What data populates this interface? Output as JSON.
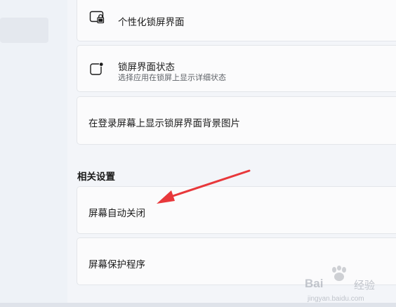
{
  "settings": {
    "rows": [
      {
        "title": "个性化锁屏界面",
        "icon": "lock-screen-icon"
      },
      {
        "title": "锁屏界面状态",
        "description": "选择应用在锁屏上显示详细状态",
        "icon": "app-status-icon"
      },
      {
        "title": "在登录屏幕上显示锁屏界面背景图片"
      }
    ],
    "related_heading": "相关设置",
    "related_rows": [
      {
        "title": "屏幕自动关闭"
      },
      {
        "title": "屏幕保护程序"
      }
    ]
  },
  "annotation": {
    "arrow_color": "#e8383b"
  },
  "watermark": {
    "brand": "Bai",
    "brand_suffix": "经验",
    "url": "jingyan.baidu.com"
  }
}
